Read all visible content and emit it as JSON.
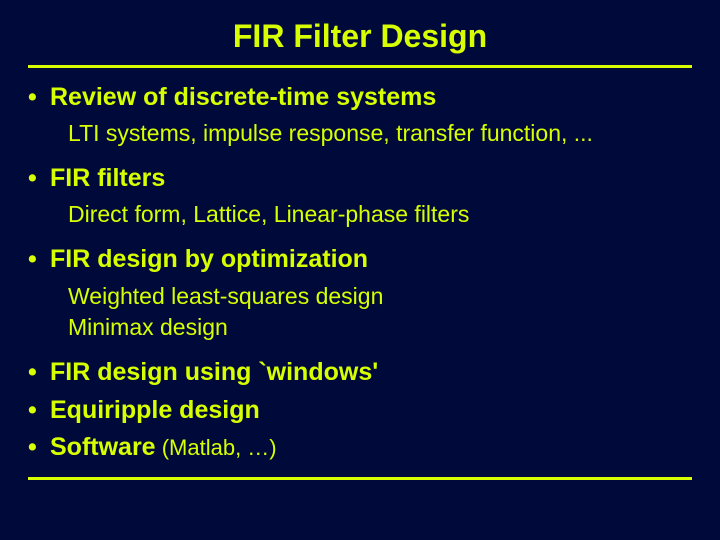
{
  "title": "FIR Filter Design",
  "items": [
    {
      "heading": "Review of discrete-time systems",
      "subs": [
        "LTI systems, impulse response, transfer function, ..."
      ]
    },
    {
      "heading": "FIR filters",
      "subs": [
        "Direct form, Lattice, Linear-phase filters"
      ]
    },
    {
      "heading": "FIR design by optimization",
      "subs": [
        "Weighted least-squares design",
        "Minimax design"
      ]
    },
    {
      "heading": "FIR design using `windows'",
      "subs": []
    },
    {
      "heading": "Equiripple design",
      "subs": []
    },
    {
      "heading": "Software",
      "note": " (Matlab, …)",
      "subs": []
    }
  ]
}
